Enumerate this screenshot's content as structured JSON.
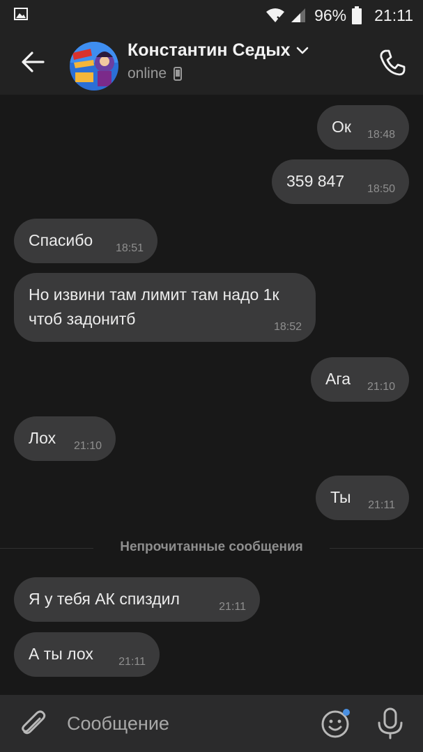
{
  "status_bar": {
    "battery_percent": "96%",
    "time": "21:11",
    "icons": [
      "gallery-icon",
      "wifi-icon",
      "signal-icon",
      "battery-icon"
    ]
  },
  "header": {
    "contact_name": "Константин Седых",
    "status": "online",
    "icons": [
      "back-arrow-icon",
      "chevron-down-icon",
      "phone-device-icon",
      "phone-call-icon"
    ]
  },
  "messages": [
    {
      "text": "Ок",
      "time": "18:48",
      "direction": "outgoing"
    },
    {
      "text": "359 847",
      "time": "18:50",
      "direction": "outgoing"
    },
    {
      "text": "Спасибо",
      "time": "18:51",
      "direction": "incoming"
    },
    {
      "text": "Но извини там лимит там надо 1к чтоб задонитб",
      "time": "18:52",
      "direction": "incoming"
    },
    {
      "text": "Ага",
      "time": "21:10",
      "direction": "outgoing"
    },
    {
      "text": "Лох",
      "time": "21:10",
      "direction": "incoming"
    },
    {
      "text": "Ты",
      "time": "21:11",
      "direction": "outgoing"
    },
    {
      "text": "Я у тебя АК спиздил",
      "time": "21:11",
      "direction": "incoming"
    },
    {
      "text": "А ты лох",
      "time": "21:11",
      "direction": "incoming"
    }
  ],
  "divider": {
    "label": "Непрочитанные сообщения"
  },
  "composer": {
    "placeholder": "Сообщение",
    "icons": [
      "paperclip-icon",
      "emoji-icon",
      "microphone-icon"
    ]
  },
  "colors": {
    "background": "#181818",
    "bubble": "#3a3a3b",
    "header": "#222222",
    "emoji_badge": "#4a90e2"
  }
}
